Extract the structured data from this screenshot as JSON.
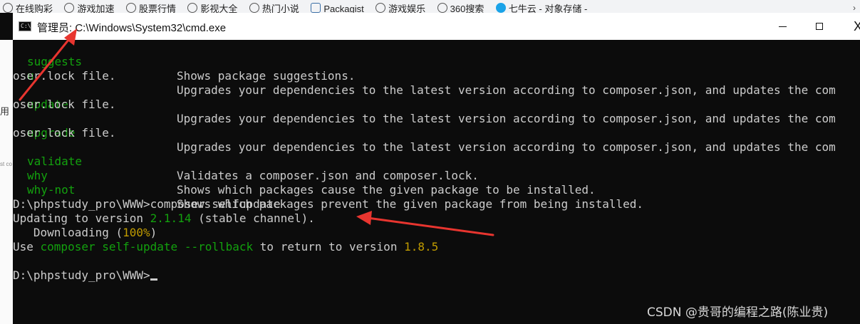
{
  "bookmarks": [
    {
      "label": "在线购彩",
      "icon": "globe-icon"
    },
    {
      "label": "游戏加速",
      "icon": "globe-icon"
    },
    {
      "label": "股票行情",
      "icon": "globe-icon"
    },
    {
      "label": "影视大全",
      "icon": "globe-icon"
    },
    {
      "label": "热门小说",
      "icon": "globe-icon"
    },
    {
      "label": "Packagist",
      "icon": "packagist-icon"
    },
    {
      "label": "游戏娱乐",
      "icon": "globe-icon"
    },
    {
      "label": "360搜索",
      "icon": "globe-icon"
    },
    {
      "label": "七牛云 - 对象存储 -",
      "icon": "qiniu-icon"
    }
  ],
  "bookmarks_more": "›",
  "left_strip": {
    "frag1": "用",
    "frag2": "st co"
  },
  "window": {
    "title": "管理员: C:\\Windows\\System32\\cmd.exe",
    "icon_text": "C:\\",
    "minimize_icon": "minimize-icon",
    "maximize_icon": "maximize-icon",
    "close_label": "X"
  },
  "console": {
    "lines": [
      {
        "cmd": "suggests",
        "desc": "Shows package suggestions."
      },
      {
        "cmd": "u",
        "desc": "Upgrades your dependencies to the latest version according to composer.json, and updates the com"
      },
      {
        "wrap": "oser.lock file."
      },
      {
        "cmd": "update",
        "desc": "Upgrades your dependencies to the latest version according to composer.json, and updates the com"
      },
      {
        "wrap": "oser.lock file."
      },
      {
        "cmd": "upgrade",
        "desc": "Upgrades your dependencies to the latest version according to composer.json, and updates the com"
      },
      {
        "wrap": "oser.lock file."
      },
      {
        "cmd": "validate",
        "desc": "Validates a composer.json and composer.lock."
      },
      {
        "cmd": "why",
        "desc": "Shows which packages cause the given package to be installed."
      },
      {
        "cmd": "why-not",
        "desc": "Shows which packages prevent the given package from being installed."
      }
    ],
    "prompt1": "D:\\phpstudy_pro\\WWW>composer selfupdate",
    "update_prefix": "Updating to version ",
    "update_version": "2.1.14",
    "update_suffix": " (stable channel).",
    "download_prefix": "   Downloading (",
    "download_pct": "100%",
    "download_suffix": ")",
    "rollback_prefix": "Use ",
    "rollback_cmd": "composer self-update --rollback",
    "rollback_mid": " to return to version ",
    "rollback_version": "1.8.5",
    "prompt2": "D:\\phpstudy_pro\\WWW>"
  },
  "watermark": "CSDN @贵哥的编程之路(陈业贵)",
  "colors": {
    "console_bg": "#0c0c0c",
    "console_text": "#cccccc",
    "command_green": "#13a10e",
    "version_yellow": "#c19c00",
    "annotation_red": "#e8352f"
  }
}
